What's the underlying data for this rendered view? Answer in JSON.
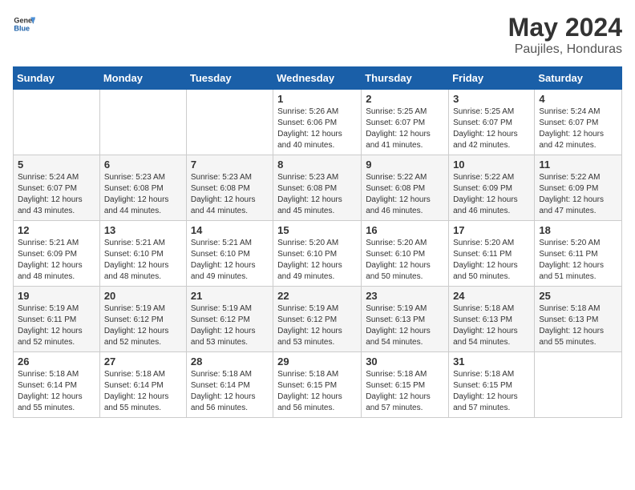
{
  "header": {
    "logo_general": "General",
    "logo_blue": "Blue",
    "month": "May 2024",
    "location": "Paujiles, Honduras"
  },
  "weekdays": [
    "Sunday",
    "Monday",
    "Tuesday",
    "Wednesday",
    "Thursday",
    "Friday",
    "Saturday"
  ],
  "weeks": [
    [
      {
        "day": "",
        "info": ""
      },
      {
        "day": "",
        "info": ""
      },
      {
        "day": "",
        "info": ""
      },
      {
        "day": "1",
        "info": "Sunrise: 5:26 AM\nSunset: 6:06 PM\nDaylight: 12 hours\nand 40 minutes."
      },
      {
        "day": "2",
        "info": "Sunrise: 5:25 AM\nSunset: 6:07 PM\nDaylight: 12 hours\nand 41 minutes."
      },
      {
        "day": "3",
        "info": "Sunrise: 5:25 AM\nSunset: 6:07 PM\nDaylight: 12 hours\nand 42 minutes."
      },
      {
        "day": "4",
        "info": "Sunrise: 5:24 AM\nSunset: 6:07 PM\nDaylight: 12 hours\nand 42 minutes."
      }
    ],
    [
      {
        "day": "5",
        "info": "Sunrise: 5:24 AM\nSunset: 6:07 PM\nDaylight: 12 hours\nand 43 minutes."
      },
      {
        "day": "6",
        "info": "Sunrise: 5:23 AM\nSunset: 6:08 PM\nDaylight: 12 hours\nand 44 minutes."
      },
      {
        "day": "7",
        "info": "Sunrise: 5:23 AM\nSunset: 6:08 PM\nDaylight: 12 hours\nand 44 minutes."
      },
      {
        "day": "8",
        "info": "Sunrise: 5:23 AM\nSunset: 6:08 PM\nDaylight: 12 hours\nand 45 minutes."
      },
      {
        "day": "9",
        "info": "Sunrise: 5:22 AM\nSunset: 6:08 PM\nDaylight: 12 hours\nand 46 minutes."
      },
      {
        "day": "10",
        "info": "Sunrise: 5:22 AM\nSunset: 6:09 PM\nDaylight: 12 hours\nand 46 minutes."
      },
      {
        "day": "11",
        "info": "Sunrise: 5:22 AM\nSunset: 6:09 PM\nDaylight: 12 hours\nand 47 minutes."
      }
    ],
    [
      {
        "day": "12",
        "info": "Sunrise: 5:21 AM\nSunset: 6:09 PM\nDaylight: 12 hours\nand 48 minutes."
      },
      {
        "day": "13",
        "info": "Sunrise: 5:21 AM\nSunset: 6:10 PM\nDaylight: 12 hours\nand 48 minutes."
      },
      {
        "day": "14",
        "info": "Sunrise: 5:21 AM\nSunset: 6:10 PM\nDaylight: 12 hours\nand 49 minutes."
      },
      {
        "day": "15",
        "info": "Sunrise: 5:20 AM\nSunset: 6:10 PM\nDaylight: 12 hours\nand 49 minutes."
      },
      {
        "day": "16",
        "info": "Sunrise: 5:20 AM\nSunset: 6:10 PM\nDaylight: 12 hours\nand 50 minutes."
      },
      {
        "day": "17",
        "info": "Sunrise: 5:20 AM\nSunset: 6:11 PM\nDaylight: 12 hours\nand 50 minutes."
      },
      {
        "day": "18",
        "info": "Sunrise: 5:20 AM\nSunset: 6:11 PM\nDaylight: 12 hours\nand 51 minutes."
      }
    ],
    [
      {
        "day": "19",
        "info": "Sunrise: 5:19 AM\nSunset: 6:11 PM\nDaylight: 12 hours\nand 52 minutes."
      },
      {
        "day": "20",
        "info": "Sunrise: 5:19 AM\nSunset: 6:12 PM\nDaylight: 12 hours\nand 52 minutes."
      },
      {
        "day": "21",
        "info": "Sunrise: 5:19 AM\nSunset: 6:12 PM\nDaylight: 12 hours\nand 53 minutes."
      },
      {
        "day": "22",
        "info": "Sunrise: 5:19 AM\nSunset: 6:12 PM\nDaylight: 12 hours\nand 53 minutes."
      },
      {
        "day": "23",
        "info": "Sunrise: 5:19 AM\nSunset: 6:13 PM\nDaylight: 12 hours\nand 54 minutes."
      },
      {
        "day": "24",
        "info": "Sunrise: 5:18 AM\nSunset: 6:13 PM\nDaylight: 12 hours\nand 54 minutes."
      },
      {
        "day": "25",
        "info": "Sunrise: 5:18 AM\nSunset: 6:13 PM\nDaylight: 12 hours\nand 55 minutes."
      }
    ],
    [
      {
        "day": "26",
        "info": "Sunrise: 5:18 AM\nSunset: 6:14 PM\nDaylight: 12 hours\nand 55 minutes."
      },
      {
        "day": "27",
        "info": "Sunrise: 5:18 AM\nSunset: 6:14 PM\nDaylight: 12 hours\nand 55 minutes."
      },
      {
        "day": "28",
        "info": "Sunrise: 5:18 AM\nSunset: 6:14 PM\nDaylight: 12 hours\nand 56 minutes."
      },
      {
        "day": "29",
        "info": "Sunrise: 5:18 AM\nSunset: 6:15 PM\nDaylight: 12 hours\nand 56 minutes."
      },
      {
        "day": "30",
        "info": "Sunrise: 5:18 AM\nSunset: 6:15 PM\nDaylight: 12 hours\nand 57 minutes."
      },
      {
        "day": "31",
        "info": "Sunrise: 5:18 AM\nSunset: 6:15 PM\nDaylight: 12 hours\nand 57 minutes."
      },
      {
        "day": "",
        "info": ""
      }
    ]
  ]
}
